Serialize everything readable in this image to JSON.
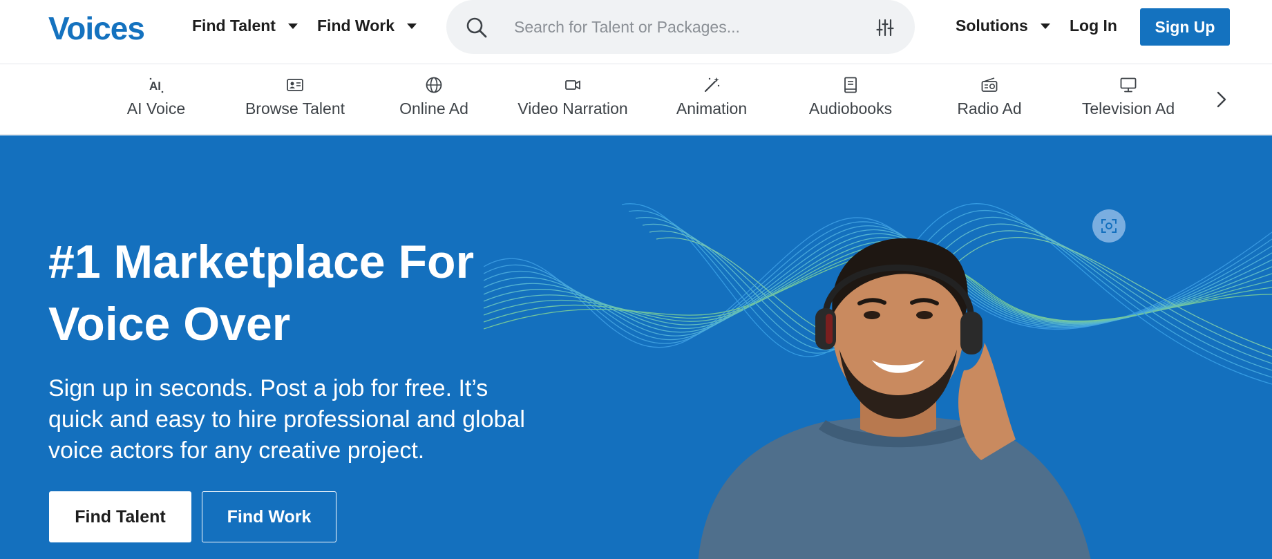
{
  "header": {
    "logo": "Voices",
    "find_talent": "Find Talent",
    "find_work": "Find Work",
    "search_placeholder": "Search for Talent or Packages...",
    "solutions": "Solutions",
    "login": "Log In",
    "signup": "Sign Up"
  },
  "categories": [
    {
      "label": "AI Voice",
      "icon": "ai-icon"
    },
    {
      "label": "Browse Talent",
      "icon": "id-card-icon"
    },
    {
      "label": "Online Ad",
      "icon": "globe-icon"
    },
    {
      "label": "Video Narration",
      "icon": "video-camera-icon"
    },
    {
      "label": "Animation",
      "icon": "magic-wand-icon"
    },
    {
      "label": "Audiobooks",
      "icon": "book-icon"
    },
    {
      "label": "Radio Ad",
      "icon": "radio-icon"
    },
    {
      "label": "Television Ad",
      "icon": "monitor-icon"
    }
  ],
  "hero": {
    "title": "#1 Marketplace For Voice Over",
    "subtitle": "Sign up in seconds. Post a job for free. It’s quick and easy to hire professional and global voice actors for any creative project.",
    "cta_talent": "Find Talent",
    "cta_work": "Find Work"
  },
  "colors": {
    "brand": "#1472bf",
    "hero_bg": "#1470be"
  }
}
